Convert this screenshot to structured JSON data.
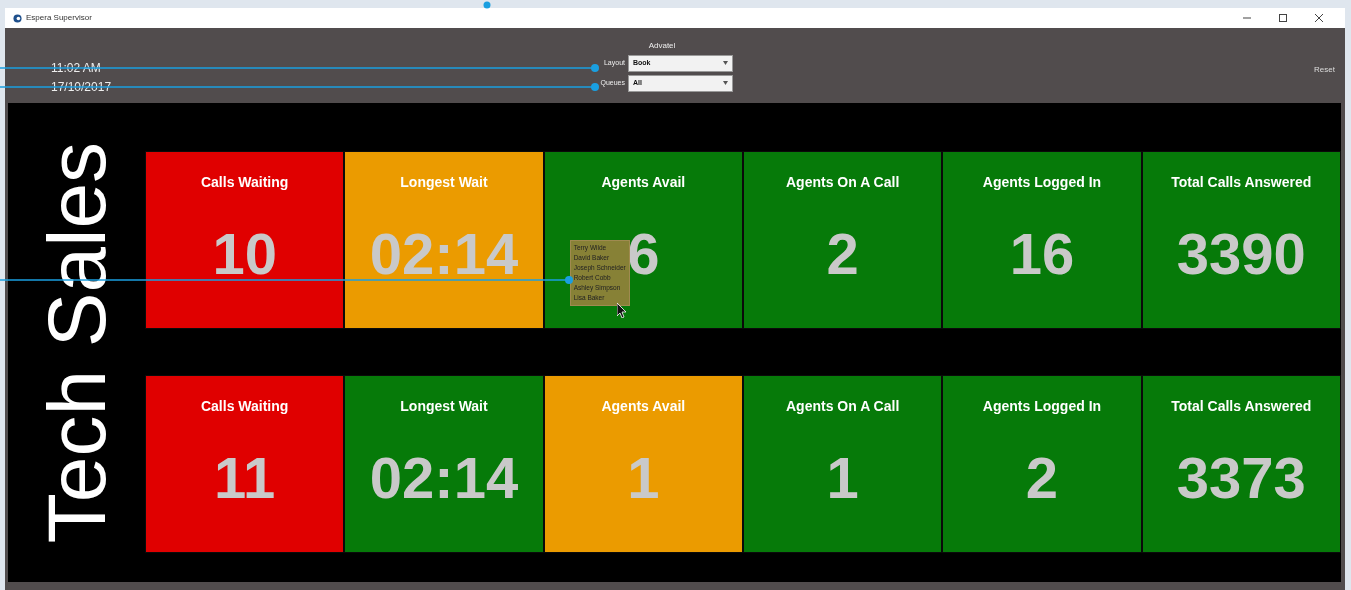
{
  "window": {
    "title": "Espera Supervisor"
  },
  "header": {
    "time": "11:02 AM",
    "date": "17/10/2017",
    "group_title": "Advatel",
    "fields": [
      {
        "label": "Layout",
        "value": "Book"
      },
      {
        "label": "Queues",
        "value": "All"
      }
    ],
    "reset": "Reset"
  },
  "queue": {
    "name": "Tech Sales"
  },
  "rows": [
    {
      "tiles": [
        {
          "title": "Calls Waiting",
          "value": "10",
          "color": "#e00000"
        },
        {
          "title": "Longest Wait",
          "value": "02:14",
          "color": "#eb9b00"
        },
        {
          "title": "Agents Avail",
          "value": "6",
          "color": "#067a09",
          "agent_list": [
            "Terry Wilde",
            "David Baker",
            "Joseph Schneider",
            "Robert Cobb",
            "Ashley Simpson",
            "Lisa Baker"
          ]
        },
        {
          "title": "Agents On A Call",
          "value": "2",
          "color": "#067a09"
        },
        {
          "title": "Agents Logged In",
          "value": "16",
          "color": "#067a09"
        },
        {
          "title": "Total Calls Answered",
          "value": "3390",
          "color": "#067a09"
        }
      ]
    },
    {
      "tiles": [
        {
          "title": "Calls Waiting",
          "value": "11",
          "color": "#e00000"
        },
        {
          "title": "Longest Wait",
          "value": "02:14",
          "color": "#067a09"
        },
        {
          "title": "Agents Avail",
          "value": "1",
          "color": "#eb9b00"
        },
        {
          "title": "Agents On A Call",
          "value": "1",
          "color": "#067a09"
        },
        {
          "title": "Agents Logged In",
          "value": "2",
          "color": "#067a09"
        },
        {
          "title": "Total Calls Answered",
          "value": "3373",
          "color": "#067a09"
        }
      ]
    }
  ]
}
